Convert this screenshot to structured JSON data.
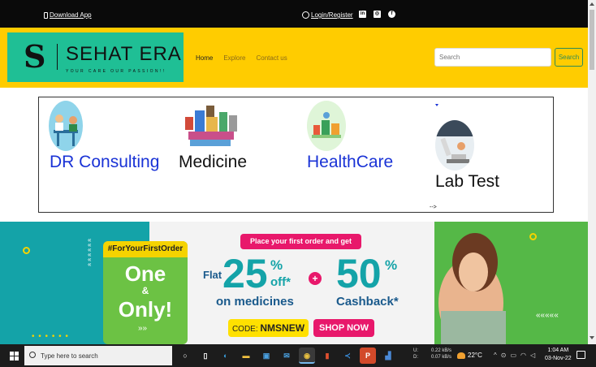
{
  "topbar": {
    "download_app": "Download App",
    "login_register": "Login/Register",
    "social_icons": [
      "linkedin-icon",
      "instagram-icon",
      "facebook-icon"
    ]
  },
  "brand": {
    "monogram": "S",
    "name": "SEHAT ERA",
    "tagline": "YOUR CARE OUR PASSION!!"
  },
  "nav": {
    "items": [
      {
        "label": "Home"
      },
      {
        "label": "Explore"
      },
      {
        "label": "Contact us"
      }
    ],
    "search_placeholder": "Search",
    "search_button": "Search"
  },
  "services": {
    "items": [
      {
        "label": "DR Consulting",
        "icon": "doctor-consulting-icon"
      },
      {
        "label": "Medicine",
        "icon": "medicine-icon"
      },
      {
        "label": "HealthCare",
        "icon": "healthcare-icon"
      },
      {
        "label": "Lab Test",
        "icon": "microscope-icon"
      }
    ],
    "stray_text": "-->"
  },
  "banner": {
    "hashtag": "#ForYourFirstOrder",
    "line1": "One",
    "amp": "&",
    "line2": "Only!",
    "place_order": "Place your first order and get",
    "flat": "Flat",
    "discount1": "25",
    "pct": "%",
    "off": "off*",
    "on_medicines": "on medicines",
    "plus": "+",
    "discount2": "50",
    "cashback": "Cashback*",
    "code_label": "CODE:",
    "code_value": "NMSNEW",
    "shop_now": "SHOP NOW"
  },
  "taskbar": {
    "search_placeholder": "Type here to search",
    "net_up_label": "U:",
    "net_down_label": "D:",
    "net_up": "0.22 kB/s",
    "net_down": "0.07 kB/s",
    "temperature": "22°C",
    "time": "1:04 AM",
    "date": "03-Nov-22"
  },
  "colors": {
    "topbar": "#0a0a0a",
    "navbar": "#ffcc00",
    "logo_bg": "#1fbf95",
    "service_blue": "#1a33d6",
    "banner_teal": "#14a3a8",
    "banner_pink": "#e8186b",
    "banner_green": "#55b847"
  }
}
